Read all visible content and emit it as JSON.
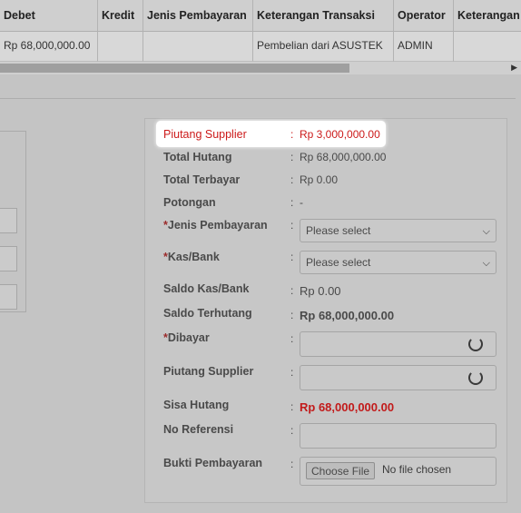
{
  "table": {
    "headers": [
      "Debet",
      "Kredit",
      "Jenis Pembayaran",
      "Keterangan Transaksi",
      "Operator",
      "Keterangan"
    ],
    "row": [
      "Rp 68,000,000.00",
      "",
      "",
      "Pembelian dari ASUSTEK",
      "ADMIN",
      ""
    ]
  },
  "form": {
    "piutang_supplier_top": {
      "label": "Piutang Supplier",
      "value": "Rp 3,000,000.00"
    },
    "total_hutang": {
      "label": "Total Hutang",
      "value": "Rp 68,000,000.00"
    },
    "total_terbayar": {
      "label": "Total Terbayar",
      "value": "Rp 0.00"
    },
    "potongan": {
      "label": "Potongan",
      "value": "-"
    },
    "jenis_pembayaran": {
      "label": "Jenis Pembayaran",
      "required": "*",
      "placeholder": "Please select"
    },
    "kas_bank": {
      "label": "Kas/Bank",
      "required": "*",
      "placeholder": "Please select"
    },
    "saldo_kas_bank": {
      "label": "Saldo Kas/Bank",
      "value": "Rp 0.00"
    },
    "saldo_terhutang": {
      "label": "Saldo Terhutang",
      "value": "Rp 68,000,000.00"
    },
    "dibayar": {
      "label": "Dibayar",
      "required": "*"
    },
    "piutang_supplier_input": {
      "label": "Piutang Supplier"
    },
    "sisa_hutang": {
      "label": "Sisa Hutang",
      "value": "Rp 68,000,000.00"
    },
    "no_referensi": {
      "label": "No Referensi"
    },
    "bukti_pembayaran": {
      "label": "Bukti Pembayaran",
      "button": "Choose File",
      "status": "No file chosen"
    },
    "colon": ":"
  },
  "colors": {
    "highlight_red": "#cc1a1a",
    "overlay_gray": "#c4c4c4"
  }
}
